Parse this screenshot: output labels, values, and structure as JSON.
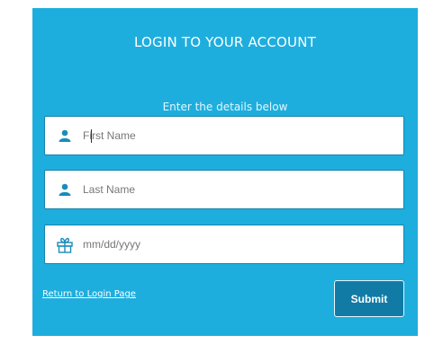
{
  "form": {
    "title": "LOGIN TO YOUR ACCOUNT",
    "subtitle": "Enter the details below",
    "fields": [
      {
        "icon": "user-icon",
        "placeholder": "First Name",
        "value": ""
      },
      {
        "icon": "user-icon",
        "placeholder": "Last Name",
        "value": ""
      },
      {
        "icon": "gift-icon",
        "placeholder": "mm/dd/yyyy",
        "value": ""
      }
    ],
    "return_link": "Return to Login Page",
    "submit_label": "Submit"
  },
  "colors": {
    "panel_bg": "#1eaede",
    "icon": "#1a8cba",
    "submit_bg": "#117ba6"
  }
}
